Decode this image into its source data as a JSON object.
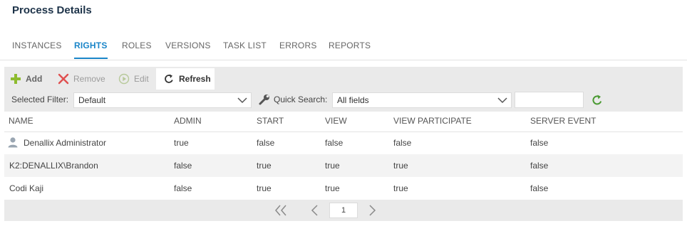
{
  "page": {
    "title": "Process Details"
  },
  "tabs": [
    {
      "label": "INSTANCES"
    },
    {
      "label": "RIGHTS",
      "active": true
    },
    {
      "label": "ROLES"
    },
    {
      "label": "VERSIONS"
    },
    {
      "label": "TASK LIST"
    },
    {
      "label": "ERRORS"
    },
    {
      "label": "REPORTS"
    }
  ],
  "toolbar": {
    "add_label": "Add",
    "remove_label": "Remove",
    "edit_label": "Edit",
    "refresh_label": "Refresh",
    "add_icon": "plus-icon",
    "remove_icon": "x-icon",
    "edit_icon": "play-circle-icon",
    "refresh_icon": "refresh-icon"
  },
  "filter": {
    "label": "Selected Filter:",
    "value": "Default",
    "quick_search_label": "Quick Search:",
    "quick_search_field": "All fields",
    "quick_search_value": ""
  },
  "table": {
    "columns": [
      "NAME",
      "ADMIN",
      "START",
      "VIEW",
      "VIEW PARTICIPATE",
      "SERVER EVENT"
    ],
    "rows": [
      {
        "name": "Denallix Administrator",
        "admin": "true",
        "start": "false",
        "view": "false",
        "view_participate": "false",
        "server_event": "false",
        "icon": "user-icon"
      },
      {
        "name": "K2:DENALLIX\\Brandon",
        "admin": "false",
        "start": "true",
        "view": "true",
        "view_participate": "true",
        "server_event": "false"
      },
      {
        "name": "Codi Kaji",
        "admin": "false",
        "start": "true",
        "view": "true",
        "view_participate": "true",
        "server_event": "false"
      }
    ]
  },
  "pager": {
    "page": "1"
  },
  "colors": {
    "accent": "#1a85c8",
    "add_green": "#8dbb2f",
    "remove_red": "#e05050",
    "refresh_green": "#4a9a32"
  }
}
